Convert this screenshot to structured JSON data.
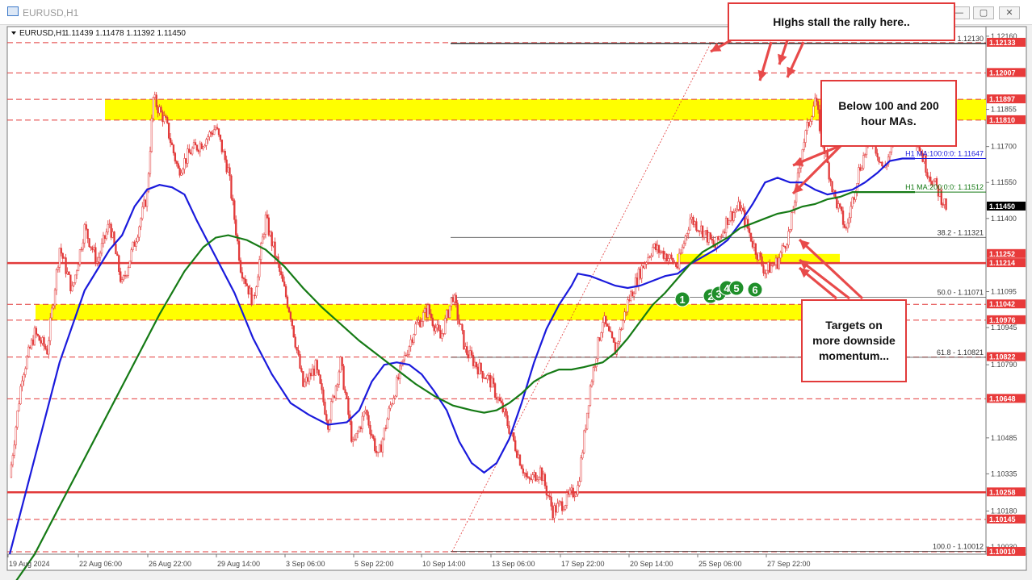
{
  "window": {
    "title": "EURUSD,H1",
    "buttons": {
      "minimize": "—",
      "restore": "▢",
      "close": "✕"
    }
  },
  "chart_data": {
    "type": "candlestick",
    "symbol": "EURUSD,H1",
    "ohlc_header": "1.11439 1.11478 1.11392 1.11450",
    "ylim": [
      1.1,
      1.122
    ],
    "price_axis_ticks": [
      "1.12160",
      "1.11855",
      "1.11700",
      "1.11550",
      "1.11400",
      "1.11095",
      "1.10945",
      "1.10790",
      "1.10485",
      "1.10335",
      "1.10180",
      "1.10030"
    ],
    "x_ticks": [
      "19 Aug 2024",
      "22 Aug 06:00",
      "26 Aug 22:00",
      "29 Aug 14:00",
      "3 Sep 06:00",
      "5 Sep 22:00",
      "10 Sep 14:00",
      "13 Sep 06:00",
      "17 Sep 22:00",
      "20 Sep 14:00",
      "25 Sep 06:00",
      "27 Sep 22:00"
    ],
    "current_price": "1.11450",
    "close_path": [
      [
        0,
        1.1032
      ],
      [
        2,
        1.1075
      ],
      [
        4,
        1.1092
      ],
      [
        6,
        1.1085
      ],
      [
        8,
        1.1128
      ],
      [
        10,
        1.111
      ],
      [
        12,
        1.1136
      ],
      [
        14,
        1.1122
      ],
      [
        16,
        1.1138
      ],
      [
        18,
        1.1112
      ],
      [
        20,
        1.113
      ],
      [
        22,
        1.115
      ],
      [
        23,
        1.119
      ],
      [
        25,
        1.118
      ],
      [
        27,
        1.116
      ],
      [
        29,
        1.1168
      ],
      [
        31,
        1.1172
      ],
      [
        33,
        1.1178
      ],
      [
        35,
        1.116
      ],
      [
        37,
        1.112
      ],
      [
        39,
        1.1105
      ],
      [
        41,
        1.114
      ],
      [
        43,
        1.112
      ],
      [
        45,
        1.11
      ],
      [
        47,
        1.107
      ],
      [
        49,
        1.1078
      ],
      [
        51,
        1.1055
      ],
      [
        53,
        1.108
      ],
      [
        55,
        1.1045
      ],
      [
        57,
        1.106
      ],
      [
        59,
        1.104
      ],
      [
        61,
        1.1062
      ],
      [
        63,
        1.108
      ],
      [
        65,
        1.1095
      ],
      [
        67,
        1.1102
      ],
      [
        69,
        1.109
      ],
      [
        71,
        1.1108
      ],
      [
        73,
        1.1085
      ],
      [
        75,
        1.1078
      ],
      [
        77,
        1.1072
      ],
      [
        79,
        1.106
      ],
      [
        81,
        1.1045
      ],
      [
        83,
        1.103
      ],
      [
        85,
        1.1035
      ],
      [
        87,
        1.1018
      ],
      [
        89,
        1.1022
      ],
      [
        91,
        1.1028
      ],
      [
        93,
        1.107
      ],
      [
        95,
        1.1098
      ],
      [
        97,
        1.1085
      ],
      [
        99,
        1.1105
      ],
      [
        101,
        1.1118
      ],
      [
        103,
        1.1128
      ],
      [
        105,
        1.1125
      ],
      [
        107,
        1.112
      ],
      [
        109,
        1.114
      ],
      [
        111,
        1.1135
      ],
      [
        113,
        1.1128
      ],
      [
        115,
        1.114
      ],
      [
        117,
        1.1145
      ],
      [
        119,
        1.113
      ],
      [
        121,
        1.1118
      ],
      [
        123,
        1.1122
      ],
      [
        125,
        1.1135
      ],
      [
        127,
        1.117
      ],
      [
        129,
        1.119
      ],
      [
        130,
        1.1175
      ],
      [
        132,
        1.115
      ],
      [
        134,
        1.1135
      ],
      [
        136,
        1.116
      ],
      [
        138,
        1.1175
      ],
      [
        140,
        1.116
      ],
      [
        142,
        1.1175
      ],
      [
        143,
        1.1195
      ],
      [
        145,
        1.1175
      ],
      [
        147,
        1.116
      ],
      [
        149,
        1.115
      ],
      [
        150,
        1.1145
      ]
    ],
    "moving_averages": [
      {
        "label": "H1 MA:100:0:0: 1.11647",
        "color": "#1a1adc",
        "points": [
          [
            0,
            1.1
          ],
          [
            4,
            1.104
          ],
          [
            8,
            1.108
          ],
          [
            12,
            1.111
          ],
          [
            16,
            1.1127
          ],
          [
            18,
            1.1133
          ],
          [
            20,
            1.1145
          ],
          [
            22,
            1.1152
          ],
          [
            24,
            1.1154
          ],
          [
            26,
            1.1153
          ],
          [
            28,
            1.115
          ],
          [
            30,
            1.1139
          ],
          [
            33,
            1.1124
          ],
          [
            36,
            1.1109
          ],
          [
            39,
            1.109
          ],
          [
            42,
            1.1075
          ],
          [
            45,
            1.1063
          ],
          [
            48,
            1.1058
          ],
          [
            51,
            1.1054
          ],
          [
            54,
            1.1055
          ],
          [
            56,
            1.106
          ],
          [
            58,
            1.1072
          ],
          [
            60,
            1.1079
          ],
          [
            62,
            1.108
          ],
          [
            64,
            1.1079
          ],
          [
            66,
            1.1075
          ],
          [
            68,
            1.1068
          ],
          [
            70,
            1.106
          ],
          [
            72,
            1.1047
          ],
          [
            74,
            1.1038
          ],
          [
            76,
            1.1034
          ],
          [
            78,
            1.1038
          ],
          [
            80,
            1.1048
          ],
          [
            82,
            1.1063
          ],
          [
            84,
            1.108
          ],
          [
            86,
            1.1094
          ],
          [
            88,
            1.1104
          ],
          [
            90,
            1.1112
          ],
          [
            91,
            1.1117
          ],
          [
            93,
            1.1116
          ],
          [
            95,
            1.1114
          ],
          [
            97,
            1.1112
          ],
          [
            99,
            1.1111
          ],
          [
            101,
            1.1112
          ],
          [
            103,
            1.1114
          ],
          [
            105,
            1.1116
          ],
          [
            107,
            1.1117
          ],
          [
            109,
            1.1121
          ],
          [
            111,
            1.1124
          ],
          [
            113,
            1.1127
          ],
          [
            115,
            1.1131
          ],
          [
            117,
            1.1138
          ],
          [
            119,
            1.1146
          ],
          [
            121,
            1.1155
          ],
          [
            123,
            1.1157
          ],
          [
            125,
            1.1155
          ],
          [
            127,
            1.1155
          ],
          [
            129,
            1.1152
          ],
          [
            131,
            1.115
          ],
          [
            133,
            1.1151
          ],
          [
            135,
            1.1152
          ],
          [
            137,
            1.1155
          ],
          [
            139,
            1.1159
          ],
          [
            141,
            1.1164
          ],
          [
            143,
            1.1165
          ],
          [
            145,
            1.1165
          ]
        ]
      },
      {
        "label": "H1 MA:200:0:0: 1.11512",
        "color": "#157a15",
        "points": [
          [
            0,
            1.0985
          ],
          [
            4,
            1.1
          ],
          [
            8,
            1.102
          ],
          [
            12,
            1.104
          ],
          [
            16,
            1.106
          ],
          [
            20,
            1.108
          ],
          [
            24,
            1.11
          ],
          [
            28,
            1.1118
          ],
          [
            31,
            1.1128
          ],
          [
            33,
            1.1132
          ],
          [
            35,
            1.1133
          ],
          [
            38,
            1.1131
          ],
          [
            41,
            1.1127
          ],
          [
            44,
            1.112
          ],
          [
            47,
            1.1111
          ],
          [
            50,
            1.1103
          ],
          [
            53,
            1.1096
          ],
          [
            56,
            1.1089
          ],
          [
            59,
            1.1083
          ],
          [
            62,
            1.1077
          ],
          [
            65,
            1.1071
          ],
          [
            68,
            1.1066
          ],
          [
            71,
            1.1062
          ],
          [
            74,
            1.106
          ],
          [
            76,
            1.1059
          ],
          [
            78,
            1.106
          ],
          [
            80,
            1.1063
          ],
          [
            82,
            1.1067
          ],
          [
            84,
            1.1072
          ],
          [
            86,
            1.1075
          ],
          [
            88,
            1.1077
          ],
          [
            90,
            1.1077
          ],
          [
            92,
            1.1078
          ],
          [
            95,
            1.108
          ],
          [
            97,
            1.1084
          ],
          [
            99,
            1.109
          ],
          [
            101,
            1.1097
          ],
          [
            103,
            1.1104
          ],
          [
            105,
            1.1109
          ],
          [
            107,
            1.1115
          ],
          [
            109,
            1.1121
          ],
          [
            111,
            1.1126
          ],
          [
            113,
            1.1129
          ],
          [
            115,
            1.1132
          ],
          [
            117,
            1.1136
          ],
          [
            119,
            1.1138
          ],
          [
            121,
            1.114
          ],
          [
            123,
            1.1142
          ],
          [
            125,
            1.1143
          ],
          [
            127,
            1.1145
          ],
          [
            129,
            1.1146
          ],
          [
            131,
            1.1148
          ],
          [
            133,
            1.1149
          ],
          [
            135,
            1.1151
          ],
          [
            137,
            1.1151
          ],
          [
            139,
            1.1151
          ],
          [
            141,
            1.1151
          ],
          [
            145,
            1.1151
          ]
        ]
      }
    ],
    "support_resistance_zones": [
      {
        "from": 1.1181,
        "to": 1.11897,
        "color": "#ffff00"
      },
      {
        "from": 1.10976,
        "to": 1.11042,
        "color": "#ffff00"
      },
      {
        "from": 1.11214,
        "to": 1.11252,
        "color": "#ffff00"
      }
    ],
    "solid_red_lines": [
      1.11214,
      1.10258
    ],
    "dashed_red_lines": [
      1.12133,
      1.12007,
      1.11897,
      1.1181,
      1.11042,
      1.10976,
      1.10822,
      1.10648,
      1.10145,
      1.1001
    ],
    "price_labels": [
      {
        "text": "1.12133",
        "bg": "#e83a3a",
        "fg": "#ffffff",
        "value": 1.12133
      },
      {
        "text": "1.12007",
        "bg": "#e83a3a",
        "fg": "#ffffff",
        "value": 1.12007
      },
      {
        "text": "1.11897",
        "bg": "#e83a3a",
        "fg": "#ffffff",
        "value": 1.11897
      },
      {
        "text": "1.11810",
        "bg": "#e83a3a",
        "fg": "#ffffff",
        "value": 1.1181
      },
      {
        "text": "1.11450",
        "bg": "#000000",
        "fg": "#ffffff",
        "value": 1.1145
      },
      {
        "text": "1.11252",
        "bg": "#e83a3a",
        "fg": "#ffffff",
        "value": 1.11252
      },
      {
        "text": "1.11214",
        "bg": "#e83a3a",
        "fg": "#ffffff",
        "value": 1.11214
      },
      {
        "text": "1.11042",
        "bg": "#e83a3a",
        "fg": "#ffffff",
        "value": 1.11042
      },
      {
        "text": "1.10976",
        "bg": "#e83a3a",
        "fg": "#ffffff",
        "value": 1.10976
      },
      {
        "text": "1.10822",
        "bg": "#e83a3a",
        "fg": "#ffffff",
        "value": 1.10822
      },
      {
        "text": "1.10648",
        "bg": "#e83a3a",
        "fg": "#ffffff",
        "value": 1.10648
      },
      {
        "text": "1.10258",
        "bg": "#e83a3a",
        "fg": "#ffffff",
        "value": 1.10258
      },
      {
        "text": "1.10145",
        "bg": "#e83a3a",
        "fg": "#ffffff",
        "value": 1.10145
      },
      {
        "text": "1.10010",
        "bg": "#e83a3a",
        "fg": "#ffffff",
        "value": 1.1001
      }
    ],
    "fibonacci": {
      "color": "#555555",
      "levels": [
        {
          "label": "0.0 - 1.12130",
          "value": 1.1213
        },
        {
          "label": "38.2 - 1.11321",
          "value": 1.11321
        },
        {
          "label": "50.0 - 1.11071",
          "value": 1.11071
        },
        {
          "label": "61.8 - 1.10821",
          "value": 1.10821
        },
        {
          "label": "100.0 - 1.10012",
          "value": 1.10012
        }
      ]
    },
    "touch_markers": [
      "1",
      "2",
      "3",
      "4",
      "5",
      "6"
    ]
  },
  "annotations": {
    "highs": "HIghs stall the rally here..",
    "below_ma_line1": "Below 100 and 200",
    "below_ma_line2": "hour MAs.",
    "targets_line1": "Targets on",
    "targets_line2": "more downside",
    "targets_line3": "momentum..."
  },
  "colors": {
    "zone": "#ffff00",
    "red_line": "#e23a3a",
    "arrow": "#e84a4a",
    "candle": "#e23a3a",
    "marker": "#1f8f2a"
  }
}
